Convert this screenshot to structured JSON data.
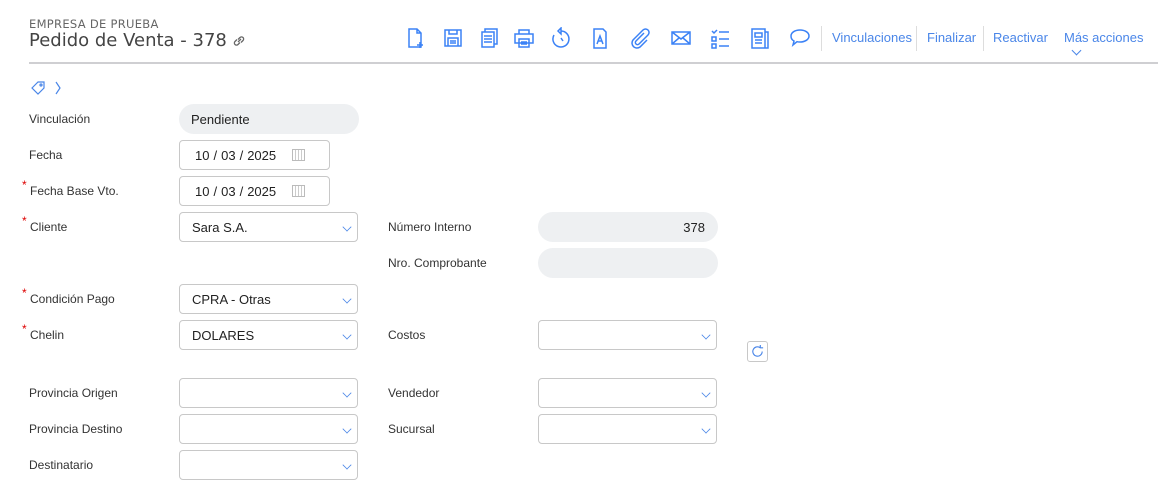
{
  "header": {
    "company": "EMPRESA DE PRUEBA",
    "title": "Pedido de Venta - 378"
  },
  "toolbar": {
    "icons": [
      "new-document-icon",
      "save-icon",
      "copy-icon",
      "print-icon",
      "history-icon",
      "document-a-icon",
      "attach-icon",
      "email-icon",
      "checklist-icon",
      "report-icon",
      "comment-icon"
    ],
    "actions": {
      "vinculaciones": "Vinculaciones",
      "finalizar": "Finalizar",
      "reactivar": "Reactivar",
      "mas": "Más acciones"
    }
  },
  "form": {
    "vinculacion": {
      "label": "Vinculación",
      "value": "Pendiente"
    },
    "fecha": {
      "label": "Fecha",
      "day": "10",
      "month": "03",
      "year": "2025"
    },
    "fecha_base": {
      "label": "Fecha Base Vto.",
      "day": "10",
      "month": "03",
      "year": "2025"
    },
    "cliente": {
      "label": "Cliente",
      "value": "Sara S.A."
    },
    "numero_interno": {
      "label": "Número Interno",
      "value": "378"
    },
    "nro_comprobante": {
      "label": "Nro. Comprobante",
      "value": ""
    },
    "condicion_pago": {
      "label": "Condición Pago",
      "value": "CPRA - Otras"
    },
    "chelin": {
      "label": "Chelin",
      "value": "DOLARES"
    },
    "costos": {
      "label": "Costos",
      "value": ""
    },
    "provincia_origen": {
      "label": "Provincia Origen",
      "value": ""
    },
    "vendedor": {
      "label": "Vendedor",
      "value": ""
    },
    "provincia_destino": {
      "label": "Provincia Destino",
      "value": ""
    },
    "sucursal": {
      "label": "Sucursal",
      "value": ""
    },
    "destinatario": {
      "label": "Destinatario",
      "value": ""
    },
    "required_mark": "*",
    "date_sep": "/"
  },
  "colors": {
    "accent": "#4a86e8",
    "required": "#dd0000"
  }
}
